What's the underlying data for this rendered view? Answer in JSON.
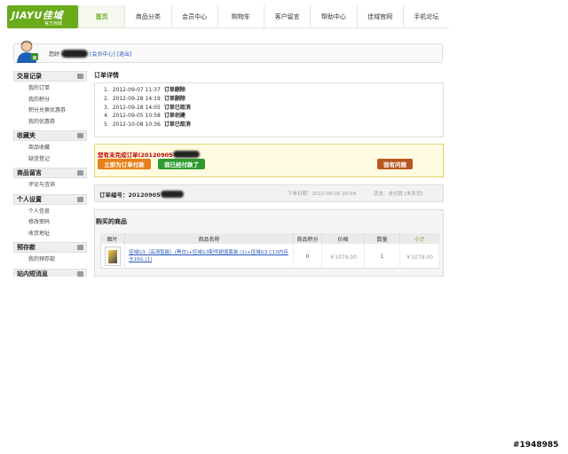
{
  "logo": {
    "main": "JIAYU佳域",
    "sub": "官方商城"
  },
  "nav": [
    "首页",
    "商品分类",
    "会员中心",
    "购物车",
    "客户留言",
    "帮助中心",
    "佳域官网",
    "手机论坛"
  ],
  "user": {
    "greeting": "您好",
    "member_center": "[会员中心]",
    "logout": "[退出]"
  },
  "sidebar": [
    {
      "title": "交易记录",
      "items": [
        "我的订单",
        "我的积分",
        "积分兑换优惠券",
        "我的优惠券"
      ]
    },
    {
      "title": "收藏夹",
      "items": [
        "商品收藏",
        "缺货登记"
      ]
    },
    {
      "title": "商品留言",
      "items": [
        "评论与咨询"
      ]
    },
    {
      "title": "个人设置",
      "items": [
        "个人信息",
        "修改密码",
        "收货地址"
      ]
    },
    {
      "title": "预存款",
      "items": [
        "我的预存款"
      ]
    },
    {
      "title": "站内短消息",
      "items": []
    }
  ],
  "detail": {
    "title": "订单详情",
    "rows": [
      {
        "n": "1.",
        "time": "2012-09-07 11:37",
        "status": "订单删除"
      },
      {
        "n": "2.",
        "time": "2012-09-28 14:19",
        "status": "订单删除"
      },
      {
        "n": "3.",
        "time": "2012-09-28 14:05",
        "status": "订单已取消"
      },
      {
        "n": "4.",
        "time": "2012-09-05 10:58",
        "status": "订单创建"
      },
      {
        "n": "5.",
        "time": "2012-10-08 10:36",
        "status": "订单已取消"
      }
    ]
  },
  "warning": {
    "text": "您有未完成订单(20120905",
    "pay_btn": "立即为订单付款",
    "paid_btn": "我已经付款了",
    "question_btn": "我有问题"
  },
  "order": {
    "no_label": "订单编号：20120905",
    "date": "下单日期：2012-09-05 10:58",
    "status": "状态：未付款 [未发货]"
  },
  "products": {
    "title": "购买的商品",
    "headers": [
      "图片",
      "商品名称",
      "商品积分",
      "价格",
      "数量",
      "小计"
    ],
    "rows": [
      {
        "name": "佳域G3（高清智能）(黑白)+佳域G3配件超值套装 (1)+佳域G3 C10内存卡16G (1)",
        "points": "0",
        "price": "￥1079.00",
        "qty": "1",
        "subtotal": "￥1079.00"
      }
    ]
  },
  "watermark": "#1948985",
  "colors": {
    "brand": "#6aab1c",
    "pay": "#e87f18",
    "paid": "#2e9b2e",
    "question": "#b85820",
    "warn_text": "#bb0000"
  }
}
